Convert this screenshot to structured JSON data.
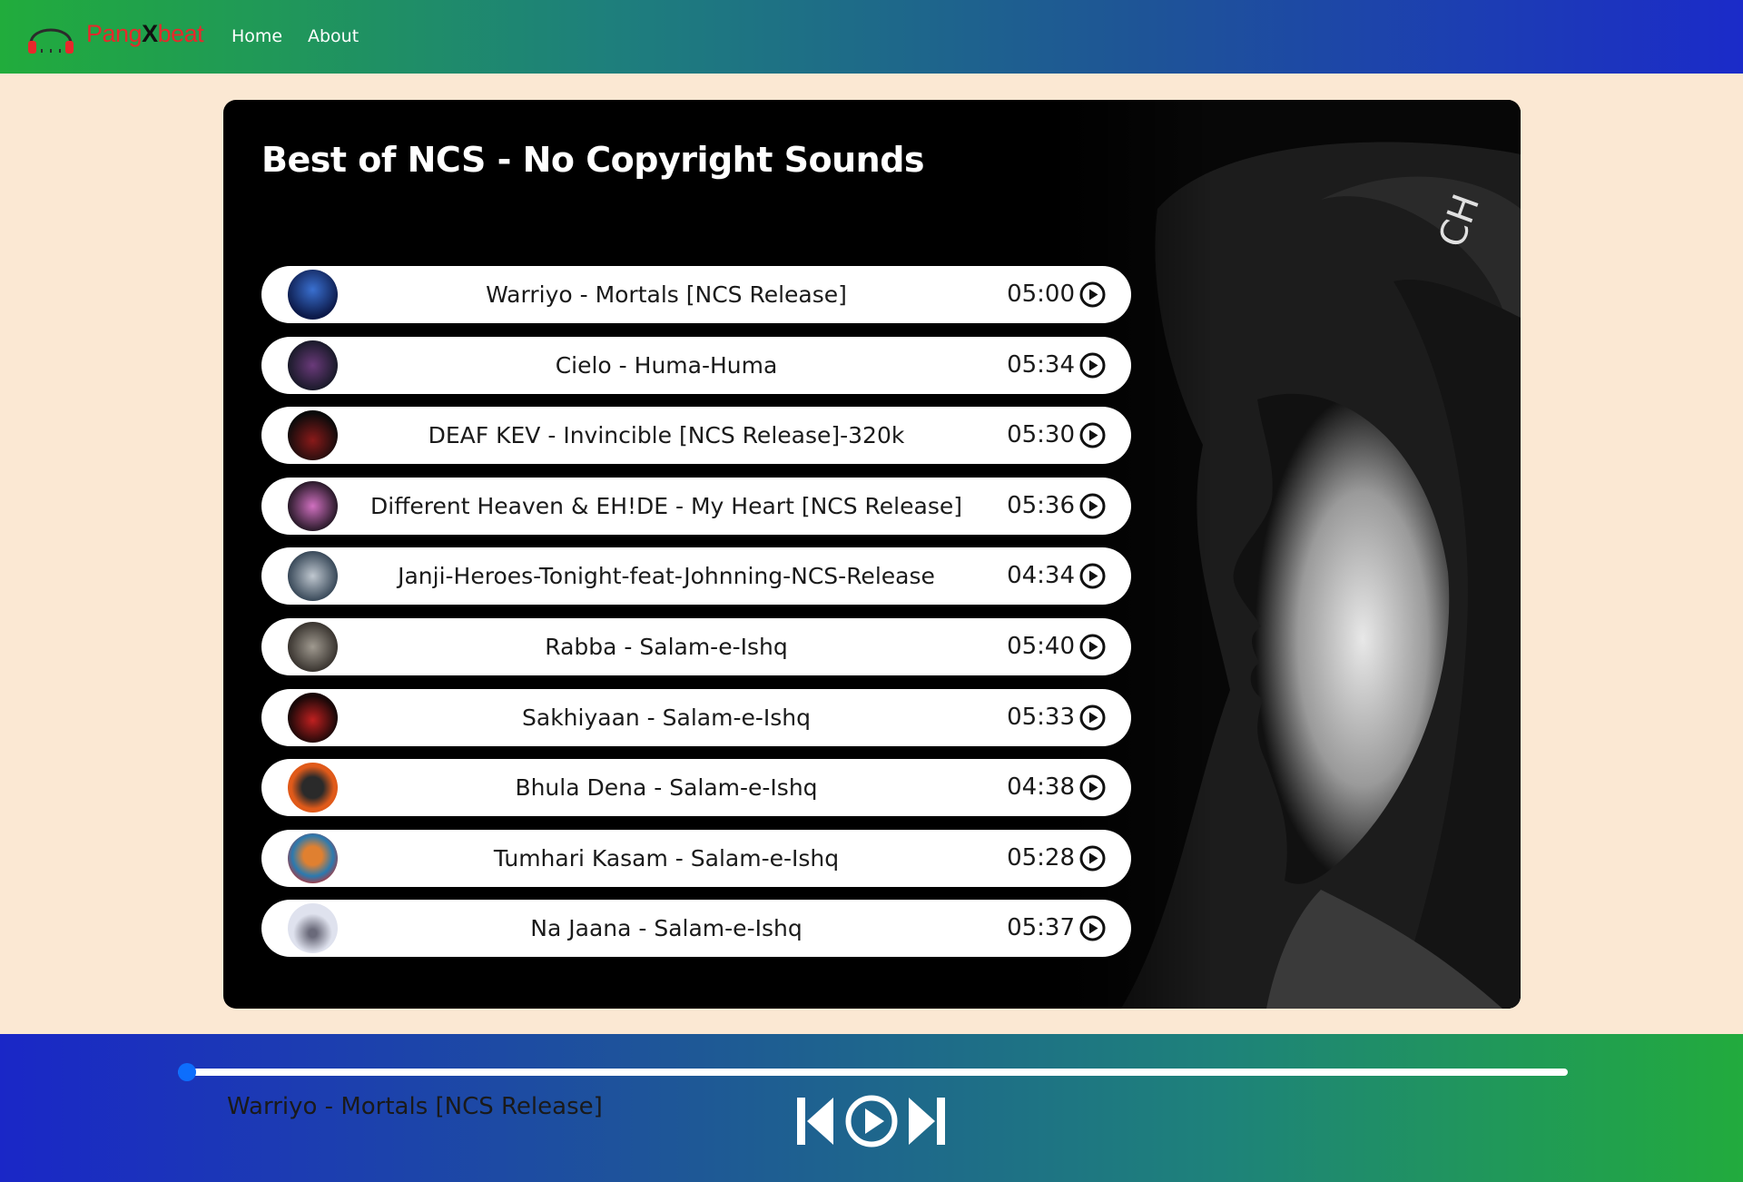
{
  "navbar": {
    "brand_part1": "Pang",
    "brand_part2": "X",
    "brand_part3": "beat",
    "links": [
      "Home",
      "About"
    ]
  },
  "playlist": {
    "title": "Best of NCS - No Copyright Sounds",
    "songs": [
      {
        "name": "Warriyo - Mortals [NCS Release]",
        "duration": "05:00",
        "cover_color": "#1a3a8a"
      },
      {
        "name": "Cielo - Huma-Huma",
        "duration": "05:34",
        "cover_color": "#3a2352"
      },
      {
        "name": "DEAF KEV - Invincible [NCS Release]-320k",
        "duration": "05:30",
        "cover_color": "#2a0c10"
      },
      {
        "name": "Different Heaven & EH!DE - My Heart [NCS Release]",
        "duration": "05:36",
        "cover_color": "#5a3a5a"
      },
      {
        "name": "Janji-Heroes-Tonight-feat-Johnning-NCS-Release",
        "duration": "04:34",
        "cover_color": "#6a7a86"
      },
      {
        "name": "Rabba - Salam-e-Ishq",
        "duration": "05:40",
        "cover_color": "#5a5550"
      },
      {
        "name": "Sakhiyaan - Salam-e-Ishq",
        "duration": "05:33",
        "cover_color": "#2a1010"
      },
      {
        "name": "Bhula Dena - Salam-e-Ishq",
        "duration": "04:38",
        "cover_color": "#e05a1a"
      },
      {
        "name": "Tumhari Kasam - Salam-e-Ishq",
        "duration": "05:28",
        "cover_color": "#2a7ab0"
      },
      {
        "name": "Na Jaana - Salam-e-Ishq",
        "duration": "05:37",
        "cover_color": "#c8cde0"
      }
    ]
  },
  "player": {
    "now_playing": "Warriyo - Mortals [NCS Release]",
    "progress_fraction": 0.0,
    "accent_color": "#0d6efd",
    "icons": [
      "skip-back-icon",
      "play-circle-icon",
      "skip-forward-icon"
    ]
  }
}
